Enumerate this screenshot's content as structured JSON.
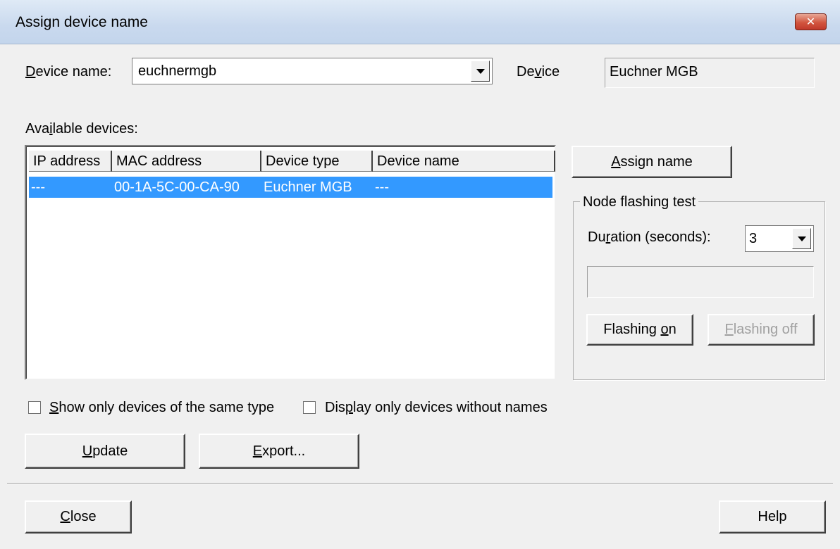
{
  "window": {
    "title": "Assign device name",
    "close_glyph": "✕"
  },
  "device_name": {
    "label_prefix": "",
    "label_mnemonic": "D",
    "label_rest": "evice name:",
    "value": "euchnermgb"
  },
  "device": {
    "label_prefix": "De",
    "label_mnemonic": "v",
    "label_rest": "ice",
    "value": "Euchner MGB"
  },
  "available_devices": {
    "label_prefix": "Ava",
    "label_mnemonic": "i",
    "label_rest": "lable devices:",
    "columns": [
      "IP address",
      "MAC address",
      "Device type",
      "Device name"
    ],
    "rows": [
      {
        "ip_address": "---",
        "mac_address": "00-1A-5C-00-CA-90",
        "device_type": "Euchner MGB",
        "device_name": "---"
      }
    ]
  },
  "assign_button": {
    "mnemonic": "A",
    "rest": "ssign name"
  },
  "node_flashing_test": {
    "title": "Node flashing test",
    "duration_label_prefix": "Du",
    "duration_label_mnemonic": "r",
    "duration_label_rest": "ation (seconds):",
    "duration_value": "3",
    "status_text": "",
    "flashing_on_prefix": "Flashing ",
    "flashing_on_mnemonic": "o",
    "flashing_on_rest": "n",
    "flashing_off_mnemonic": "F",
    "flashing_off_rest": "lashing off"
  },
  "filters": {
    "same_type_mnemonic": "S",
    "same_type_rest": "how only devices of the same type",
    "same_type_checked": false,
    "without_names_prefix": "Dis",
    "without_names_mnemonic": "p",
    "without_names_rest": "lay only devices without names",
    "without_names_checked": false
  },
  "buttons": {
    "update_mnemonic": "U",
    "update_rest": "pdate",
    "export_mnemonic": "E",
    "export_rest": "xport...",
    "close_mnemonic": "C",
    "close_rest": "lose",
    "help": "Help"
  },
  "colors": {
    "selection": "#3399ff",
    "dialog_bg": "#f0f0f0"
  }
}
